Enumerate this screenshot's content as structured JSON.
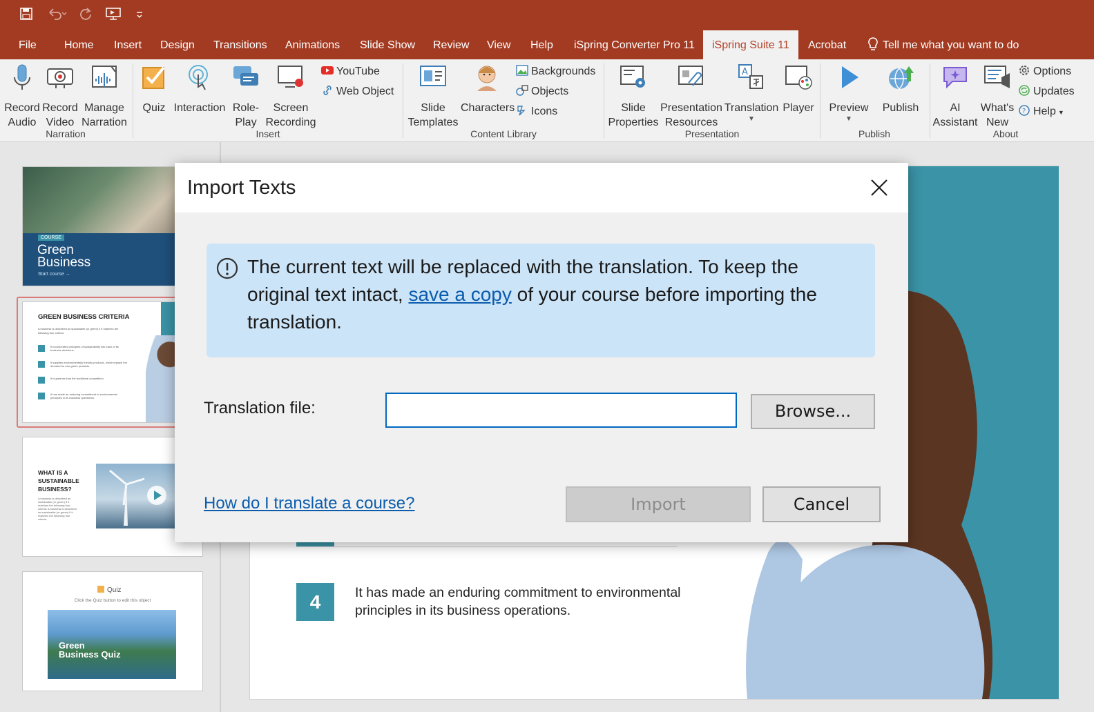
{
  "quick_access": {
    "save_icon": "save-icon",
    "undo_icon": "undo-icon",
    "redo_icon": "redo-icon",
    "present_icon": "present-icon",
    "customize_icon": "customize-icon"
  },
  "tabs": [
    "File",
    "Home",
    "Insert",
    "Design",
    "Transitions",
    "Animations",
    "Slide Show",
    "Review",
    "View",
    "Help",
    "iSpring Converter Pro 11",
    "iSpring Suite 11",
    "Acrobat"
  ],
  "active_tab": "iSpring Suite 11",
  "tell_me": "Tell me what you want to do",
  "ribbon": {
    "narration": {
      "record_audio": "Record Audio",
      "record_video": "Record Video",
      "manage_narration": "Manage Narration",
      "group": "Narration"
    },
    "insert": {
      "quiz": "Quiz",
      "interaction": "Interaction",
      "role_play": "Role-Play",
      "screen_recording": "Screen Recording",
      "youtube": "YouTube",
      "web_object": "Web Object",
      "group": "Insert"
    },
    "content_library": {
      "slide_templates": "Slide Templates",
      "characters": "Characters",
      "backgrounds": "Backgrounds",
      "objects": "Objects",
      "icons": "Icons",
      "group": "Content Library"
    },
    "presentation": {
      "slide_properties": "Slide Properties",
      "presentation_resources": "Presentation Resources",
      "translation": "Translation",
      "player": "Player",
      "group": "Presentation"
    },
    "publish": {
      "preview": "Preview",
      "publish": "Publish",
      "group": "Publish"
    },
    "about": {
      "ai_assistant": "AI Assistant",
      "whats_new": "What's New",
      "options": "Options",
      "updates": "Updates",
      "help": "Help",
      "group": "About"
    }
  },
  "thumbnails": {
    "t1": {
      "badge": "COURSE",
      "title": "Green Business",
      "cta": "Start course →"
    },
    "t2": {
      "title": "GREEN BUSINESS CRITERIA",
      "intro": "A business is described as sustainable (or green) if it matches the following four criteria:",
      "items": [
        "It incorporates principles of sustainability into each of its business decisions.",
        "It supplies environmentally friendly products, which replace the demand for non-green products.",
        "It is greener than the traditional competition.",
        "It has made an enduring commitment to environmental principles in its business operations."
      ]
    },
    "t3": {
      "title": "WHAT IS A SUSTAINABLE BUSINESS?",
      "body": "A business is described as sustainable (or green) if it matches the following four criteria: A business is described as sustainable (or green) if it matches the following four criteria."
    },
    "t4": {
      "label": "Quiz",
      "hint": "Click the Quiz button to edit this object",
      "image_text": "Green Business Quiz"
    }
  },
  "slide": {
    "item_number": "4",
    "item_text": "It has made an enduring commitment to environmental principles in its business operations."
  },
  "dialog": {
    "title": "Import Texts",
    "info_before": "The current text will be replaced with the translation. To keep the original text intact, ",
    "info_link": "save a copy",
    "info_after": " of your course before importing the translation.",
    "field_label": "Translation file:",
    "field_value": "",
    "browse": "Browse...",
    "help_link": "How do I translate a course?",
    "import": "Import",
    "cancel": "Cancel"
  },
  "colors": {
    "brand": "#a33b22",
    "accent_teal": "#3a93a6",
    "link": "#0b5cad",
    "info_bg": "#cce4f7"
  }
}
